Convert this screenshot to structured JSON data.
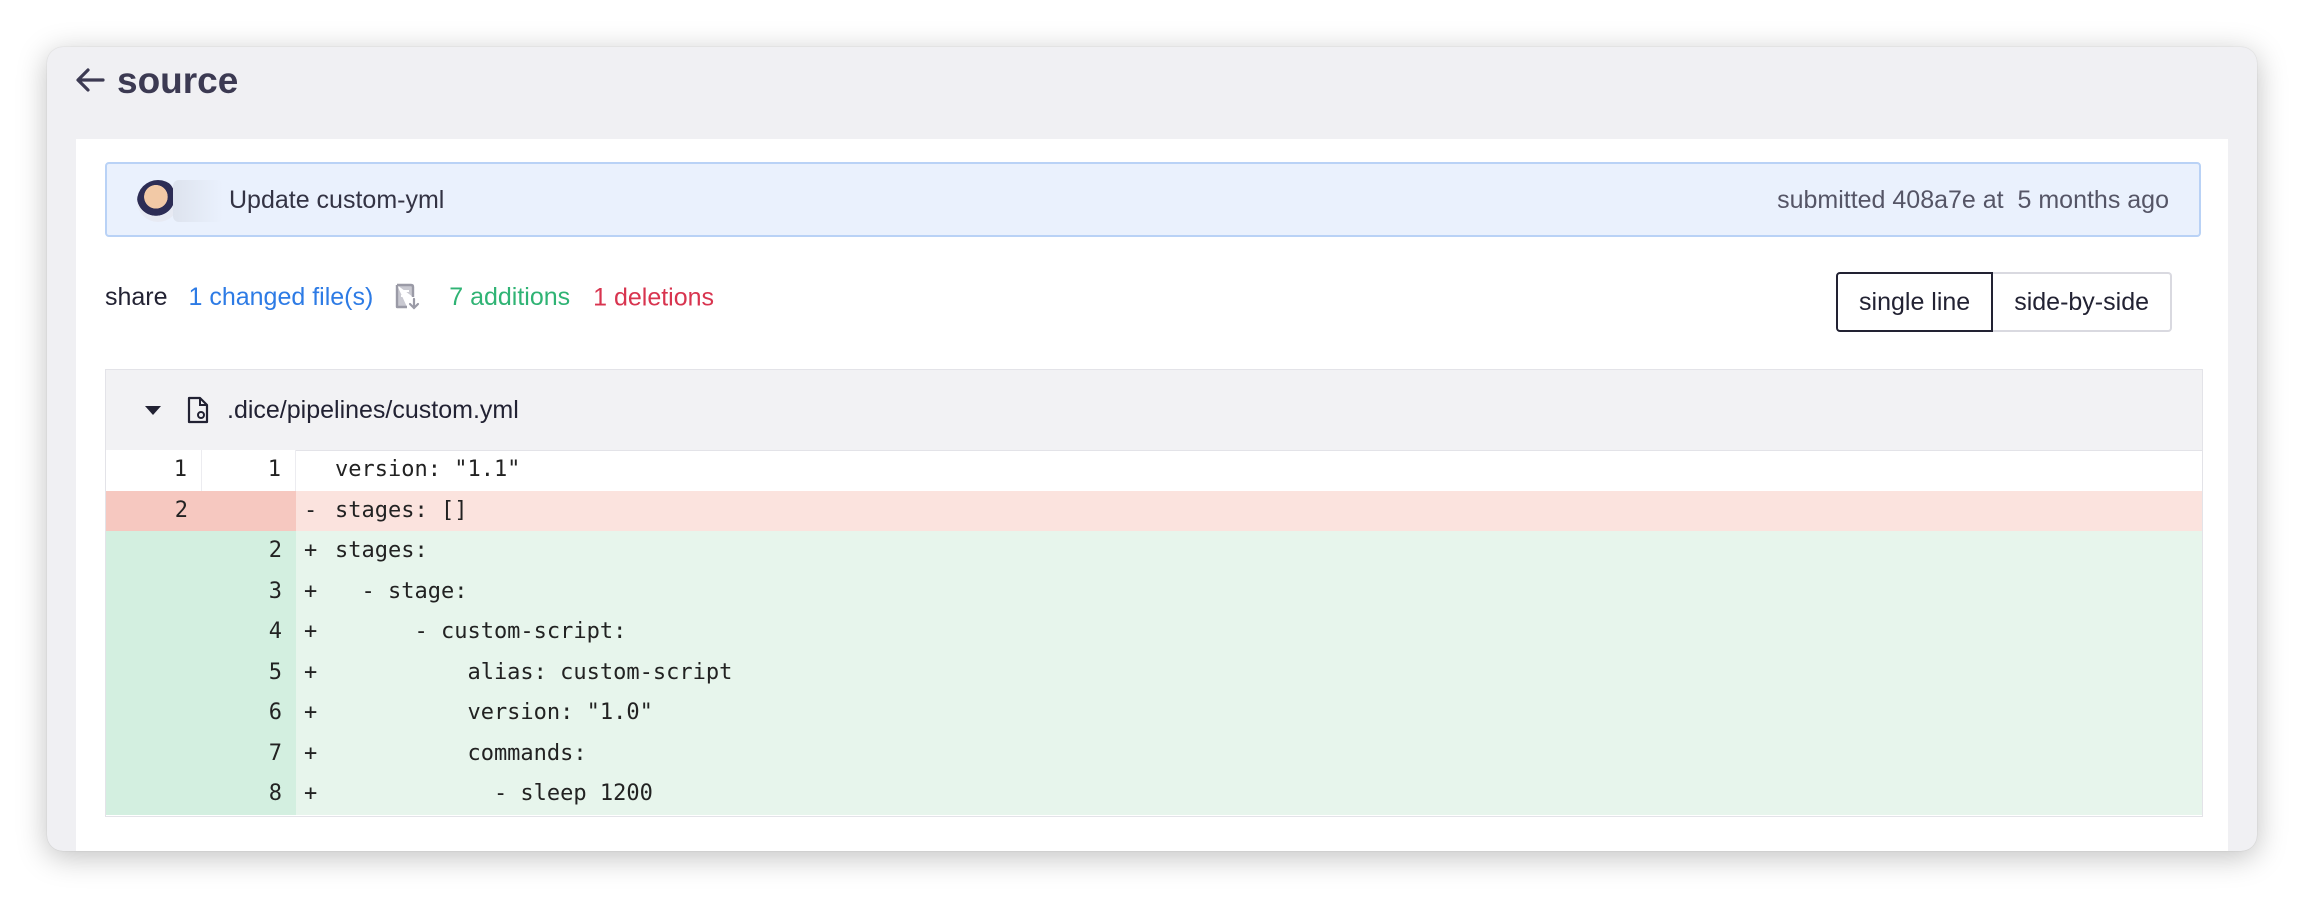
{
  "header": {
    "title": "source"
  },
  "commit": {
    "message": "Update custom-yml",
    "meta": "submitted 408a7e at  5 months ago"
  },
  "stats": {
    "share_label": "share",
    "changed_files": "1 changed file(s)",
    "additions": "7 additions",
    "deletions": "1 deletions"
  },
  "view_toggle": {
    "single_line": "single line",
    "side_by_side": "side-by-side",
    "selected": "single line"
  },
  "file": {
    "path": ".dice/pipelines/custom.yml"
  },
  "diff": {
    "rows": [
      {
        "old": "1",
        "new": "1",
        "marker": "",
        "code": "version: \"1.1\"",
        "type": "ctx"
      },
      {
        "old": "2",
        "new": "",
        "marker": "-",
        "code": "stages: []",
        "type": "del"
      },
      {
        "old": "",
        "new": "2",
        "marker": "+",
        "code": "stages:",
        "type": "add"
      },
      {
        "old": "",
        "new": "3",
        "marker": "+",
        "code": "  - stage:",
        "type": "add"
      },
      {
        "old": "",
        "new": "4",
        "marker": "+",
        "code": "      - custom-script:",
        "type": "add"
      },
      {
        "old": "",
        "new": "5",
        "marker": "+",
        "code": "          alias: custom-script",
        "type": "add"
      },
      {
        "old": "",
        "new": "6",
        "marker": "+",
        "code": "          version: \"1.0\"",
        "type": "add"
      },
      {
        "old": "",
        "new": "7",
        "marker": "+",
        "code": "          commands:",
        "type": "add"
      },
      {
        "old": "",
        "new": "8",
        "marker": "+",
        "code": "            - sleep 1200",
        "type": "add"
      }
    ]
  },
  "colors": {
    "addition": "#2fb374",
    "deletion": "#d8344f",
    "link": "#2d7be5",
    "commit_bar_bg": "#eaf1fd"
  },
  "icons": {
    "back": "arrow-left-icon",
    "changed_files": "file-download-icon",
    "collapse": "caret-down-icon",
    "file": "file-settings-icon"
  }
}
